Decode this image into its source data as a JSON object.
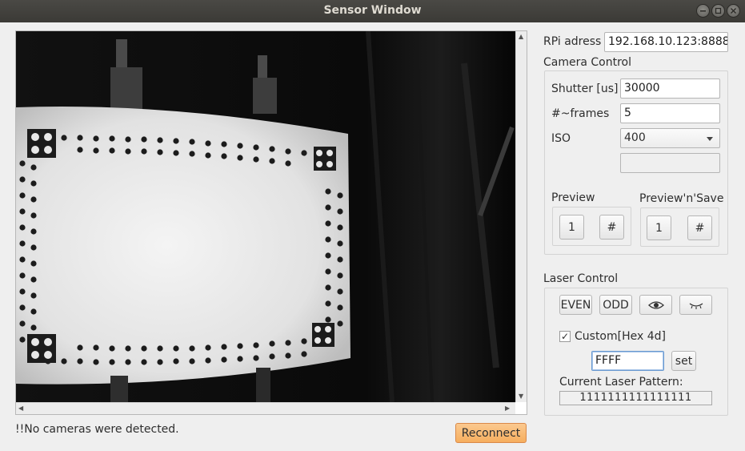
{
  "window": {
    "title": "Sensor Window"
  },
  "status": {
    "message": "!!No cameras were detected."
  },
  "buttons": {
    "reconnect": "Reconnect"
  },
  "connection": {
    "rpi_label": "RPi adress",
    "rpi_value": "192.168.10.123:8888"
  },
  "camera_control": {
    "title": "Camera Control",
    "shutter_label": "Shutter [us]",
    "shutter_value": "30000",
    "frames_label": "#~frames",
    "frames_value": "5",
    "iso_label": "ISO",
    "iso_value": "400",
    "extra_value": "",
    "preview": {
      "title": "Preview",
      "single": "1",
      "multi": "#"
    },
    "preview_save": {
      "title": "Preview'n'Save",
      "single": "1",
      "multi": "#"
    }
  },
  "laser_control": {
    "title": "Laser Control",
    "even": "EVEN",
    "odd": "ODD",
    "eye_icon": "eye-icon",
    "eye_closed_icon": "eye-closed-icon",
    "custom_checked": true,
    "checkmark": "✓",
    "custom_label": "Custom[Hex 4d]",
    "hex_value": "FFFF",
    "set": "set",
    "pattern_label": "Current Laser Pattern:",
    "pattern_value": "1111111111111111"
  },
  "colors": {
    "accent": "#f6ae5e",
    "focus": "#6a9ad1",
    "titlebar": "#3b3a36"
  }
}
